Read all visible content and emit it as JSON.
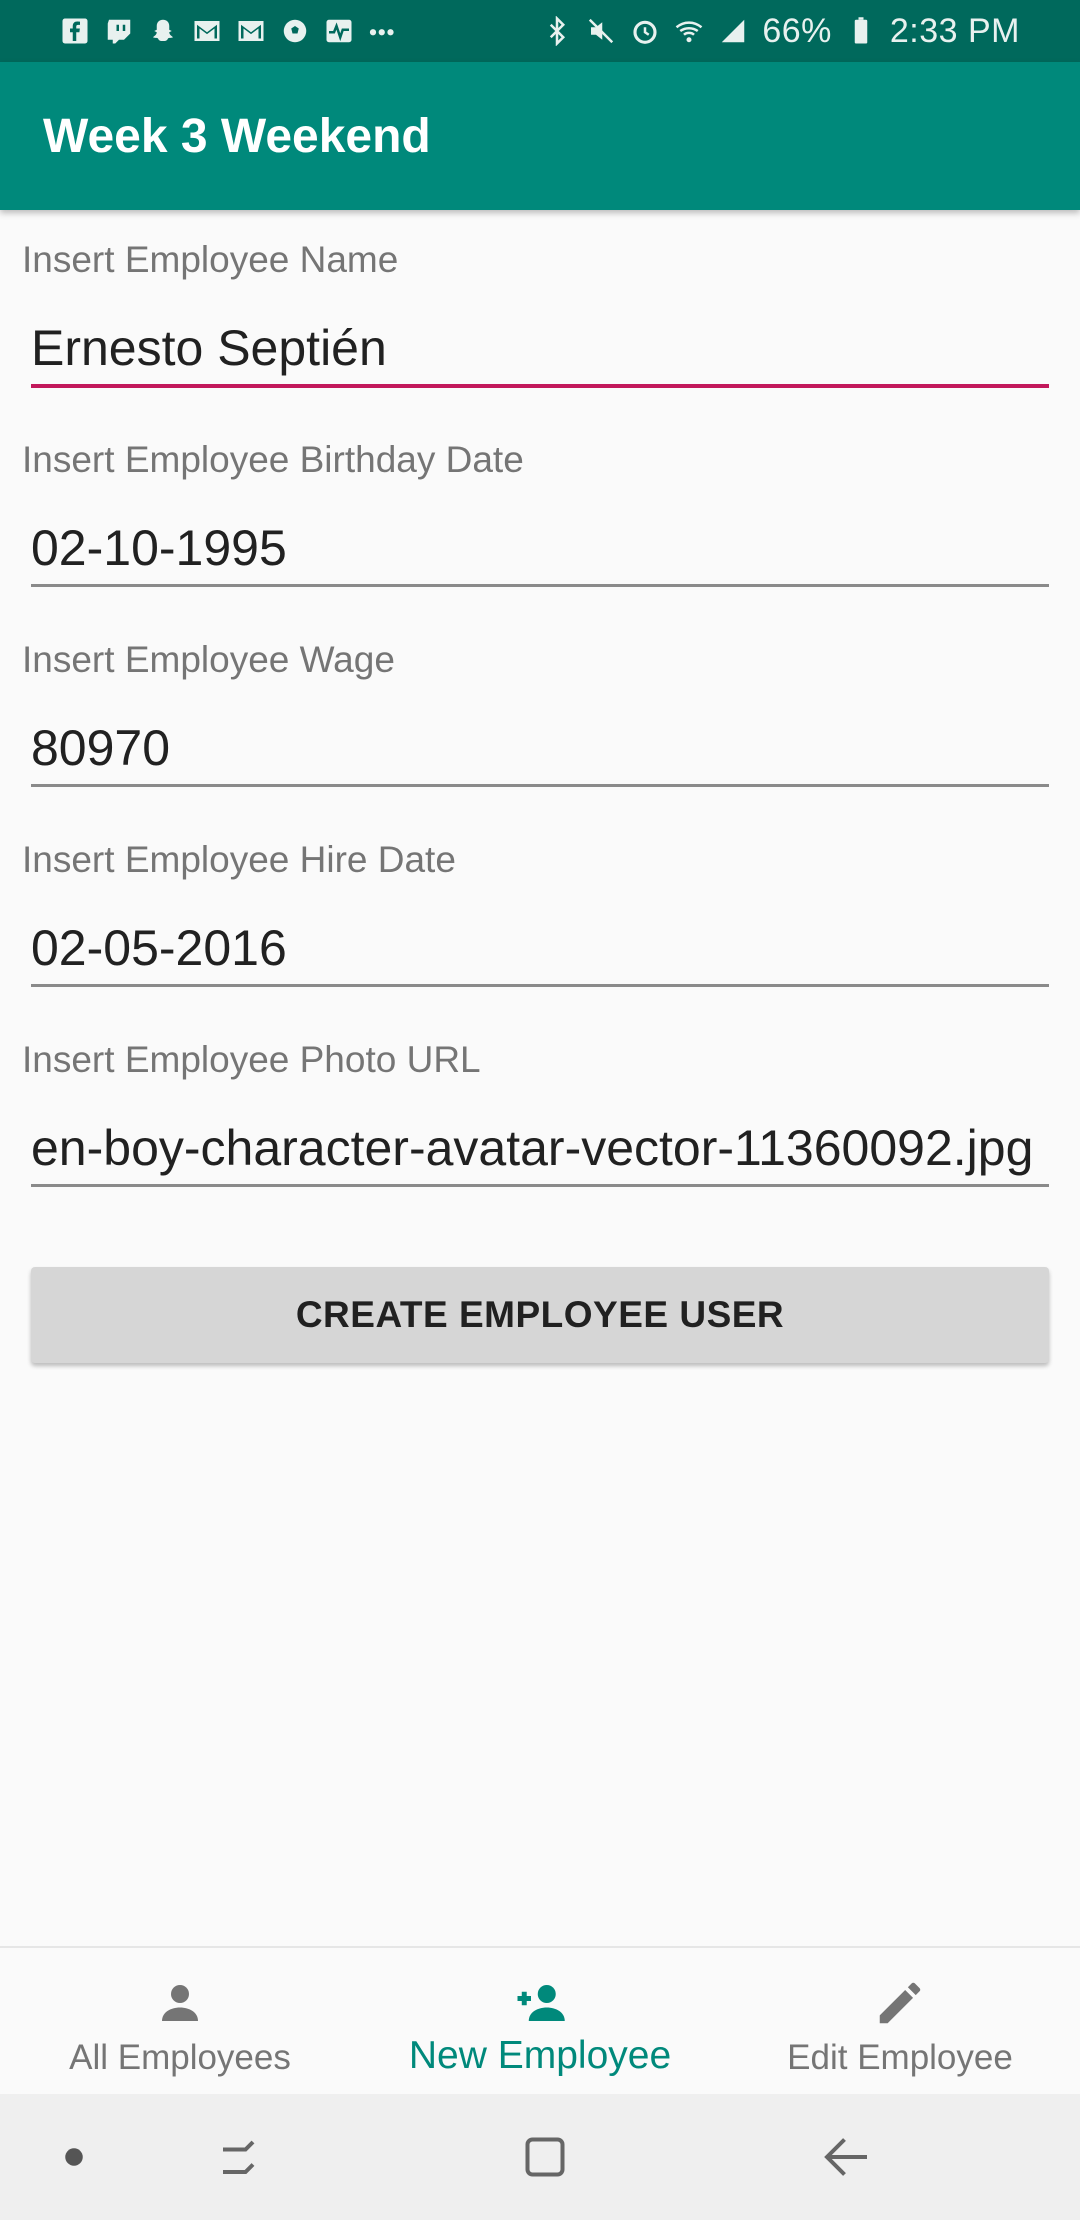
{
  "status_bar": {
    "battery": "66%",
    "time": "2:33 PM",
    "left_icons": [
      "facebook-icon",
      "twitch-icon",
      "snapchat-icon",
      "gmail-icon",
      "gmail-icon",
      "soccer-icon",
      "activity-icon",
      "more-dots-icon"
    ],
    "right_icons": [
      "bluetooth-icon",
      "mute-icon",
      "alarm-icon",
      "wifi-icon",
      "signal-icon",
      "battery-icon"
    ]
  },
  "app_bar": {
    "title": "Week 3 Weekend",
    "color": "#00897b"
  },
  "form": {
    "name": {
      "label": "Insert Employee Name",
      "value": "Ernesto Septién"
    },
    "birthday": {
      "label": "Insert Employee Birthday Date",
      "value": "02-10-1995"
    },
    "wage": {
      "label": "Insert Employee Wage",
      "value": "80970"
    },
    "hire_date": {
      "label": "Insert Employee Hire Date",
      "value": "02-05-2016"
    },
    "photo_url": {
      "label": "Insert Employee Photo URL",
      "value": "en-boy-character-avatar-vector-11360092.jpg"
    },
    "submit_label": "CREATE EMPLOYEE USER"
  },
  "bottom_nav": {
    "items": [
      {
        "label": "All Employees",
        "icon": "person-icon",
        "active": false
      },
      {
        "label": "New Employee",
        "icon": "person-add-icon",
        "active": true
      },
      {
        "label": "Edit Employee",
        "icon": "pencil-icon",
        "active": false
      }
    ],
    "active_color": "#00897b"
  },
  "accent_color": "#c2185b"
}
